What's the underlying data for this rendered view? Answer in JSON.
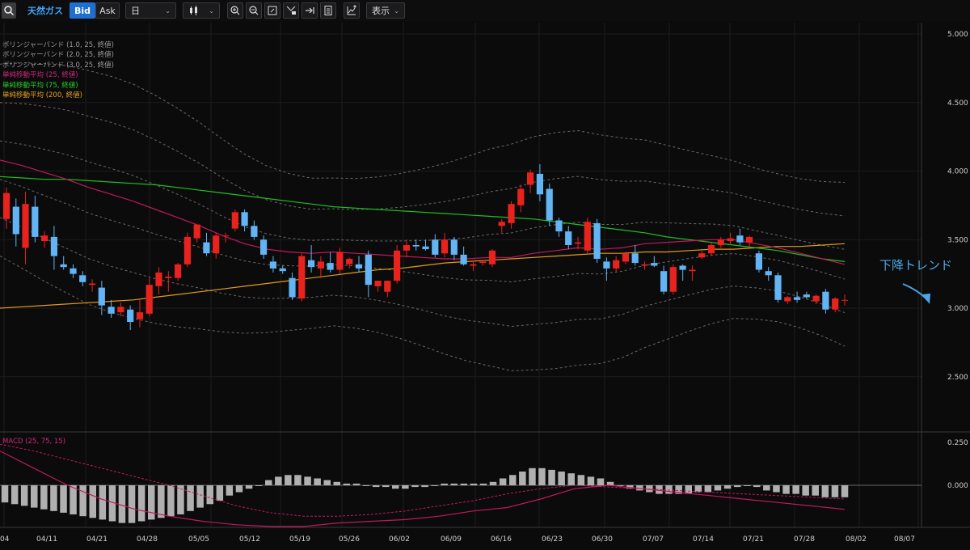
{
  "toolbar": {
    "symbol": "天然ガス",
    "bid_label": "Bid",
    "ask_label": "Ask",
    "timeframe": "日",
    "display_label": "表示"
  },
  "colors": {
    "up": "#e8221d",
    "down": "#62b4f4",
    "sma25": "#c2185b",
    "sma75": "#20c020",
    "sma200": "#e39a1e",
    "band": "#8a8a8a",
    "macd_line": "#c2185b",
    "histogram": "#b0b0b0",
    "annotation": "#4aa8ea"
  },
  "legend": {
    "bb1": "ボリンジャーバンド (1.0, 25, 終値)",
    "bb2": "ボリンジャーバンド (2.0, 25, 終値)",
    "bb3": "ボリンジャーバンド (3.0, 25, 終値)",
    "sma25": "単純移動平均 (25, 終値)",
    "sma75": "単純移動平均 (75, 終値)",
    "sma200": "単純移動平均 (200, 終値)"
  },
  "macd_legend": "MACD (25, 75, 15)",
  "annotation": "下降トレンド",
  "chart_data": [
    {
      "type": "candlestick",
      "x_ticks": [
        "04",
        "04/11",
        "04/21",
        "04/28",
        "05/05",
        "05/12",
        "05/19",
        "05/26",
        "06/02",
        "06/09",
        "06/16",
        "06/23",
        "06/30",
        "07/07",
        "07/14",
        "07/21",
        "07/28",
        "08/02",
        "08/07"
      ],
      "y_ticks": [
        "5.000",
        "4.500",
        "4.000",
        "3.500",
        "3.000",
        "2.500"
      ],
      "ylim": [
        2.2,
        5.05
      ],
      "candles": [
        {
          "o": 3.65,
          "h": 3.88,
          "l": 3.58,
          "c": 3.84
        },
        {
          "o": 3.74,
          "h": 3.8,
          "l": 3.45,
          "c": 3.54
        },
        {
          "o": 3.44,
          "h": 3.85,
          "l": 3.32,
          "c": 3.76
        },
        {
          "o": 3.74,
          "h": 3.82,
          "l": 3.48,
          "c": 3.52
        },
        {
          "o": 3.49,
          "h": 3.56,
          "l": 3.44,
          "c": 3.53
        },
        {
          "o": 3.52,
          "h": 3.6,
          "l": 3.28,
          "c": 3.38
        },
        {
          "o": 3.32,
          "h": 3.38,
          "l": 3.28,
          "c": 3.3
        },
        {
          "o": 3.29,
          "h": 3.32,
          "l": 3.22,
          "c": 3.25
        },
        {
          "o": 3.24,
          "h": 3.27,
          "l": 3.16,
          "c": 3.19
        },
        {
          "o": 3.17,
          "h": 3.21,
          "l": 3.12,
          "c": 3.18
        },
        {
          "o": 3.15,
          "h": 3.2,
          "l": 2.95,
          "c": 3.02
        },
        {
          "o": 3.01,
          "h": 3.06,
          "l": 2.93,
          "c": 2.96
        },
        {
          "o": 2.97,
          "h": 3.04,
          "l": 2.94,
          "c": 3.01
        },
        {
          "o": 2.99,
          "h": 3.02,
          "l": 2.84,
          "c": 2.9
        },
        {
          "o": 2.92,
          "h": 3.06,
          "l": 2.86,
          "c": 2.97
        },
        {
          "o": 2.96,
          "h": 3.22,
          "l": 2.94,
          "c": 3.17
        },
        {
          "o": 3.16,
          "h": 3.3,
          "l": 3.1,
          "c": 3.26
        },
        {
          "o": 3.22,
          "h": 3.27,
          "l": 3.12,
          "c": 3.23
        },
        {
          "o": 3.22,
          "h": 3.33,
          "l": 3.2,
          "c": 3.32
        },
        {
          "o": 3.32,
          "h": 3.55,
          "l": 3.3,
          "c": 3.52
        },
        {
          "o": 3.51,
          "h": 3.6,
          "l": 3.48,
          "c": 3.61
        },
        {
          "o": 3.48,
          "h": 3.55,
          "l": 3.38,
          "c": 3.4
        },
        {
          "o": 3.4,
          "h": 3.55,
          "l": 3.36,
          "c": 3.53
        },
        {
          "o": 3.53,
          "h": 3.55,
          "l": 3.48,
          "c": 3.53
        },
        {
          "o": 3.58,
          "h": 3.72,
          "l": 3.56,
          "c": 3.7
        },
        {
          "o": 3.7,
          "h": 3.72,
          "l": 3.56,
          "c": 3.6
        },
        {
          "o": 3.6,
          "h": 3.64,
          "l": 3.5,
          "c": 3.52
        },
        {
          "o": 3.5,
          "h": 3.53,
          "l": 3.36,
          "c": 3.39
        },
        {
          "o": 3.34,
          "h": 3.38,
          "l": 3.26,
          "c": 3.29
        },
        {
          "o": 3.29,
          "h": 3.31,
          "l": 3.25,
          "c": 3.27
        },
        {
          "o": 3.22,
          "h": 3.26,
          "l": 3.06,
          "c": 3.08
        },
        {
          "o": 3.07,
          "h": 3.4,
          "l": 3.05,
          "c": 3.38
        },
        {
          "o": 3.35,
          "h": 3.46,
          "l": 3.26,
          "c": 3.3
        },
        {
          "o": 3.29,
          "h": 3.38,
          "l": 3.22,
          "c": 3.34
        },
        {
          "o": 3.33,
          "h": 3.41,
          "l": 3.26,
          "c": 3.28
        },
        {
          "o": 3.28,
          "h": 3.44,
          "l": 3.25,
          "c": 3.41
        },
        {
          "o": 3.32,
          "h": 3.37,
          "l": 3.29,
          "c": 3.36
        },
        {
          "o": 3.32,
          "h": 3.38,
          "l": 3.26,
          "c": 3.29
        },
        {
          "o": 3.39,
          "h": 3.42,
          "l": 3.08,
          "c": 3.17
        },
        {
          "o": 3.16,
          "h": 3.2,
          "l": 3.12,
          "c": 3.2
        },
        {
          "o": 3.12,
          "h": 3.2,
          "l": 3.08,
          "c": 3.2
        },
        {
          "o": 3.2,
          "h": 3.46,
          "l": 3.18,
          "c": 3.42
        },
        {
          "o": 3.42,
          "h": 3.5,
          "l": 3.37,
          "c": 3.46
        },
        {
          "o": 3.46,
          "h": 3.5,
          "l": 3.42,
          "c": 3.45
        },
        {
          "o": 3.45,
          "h": 3.5,
          "l": 3.42,
          "c": 3.43
        },
        {
          "o": 3.5,
          "h": 3.54,
          "l": 3.37,
          "c": 3.39
        },
        {
          "o": 3.4,
          "h": 3.55,
          "l": 3.37,
          "c": 3.5
        },
        {
          "o": 3.5,
          "h": 3.52,
          "l": 3.35,
          "c": 3.39
        },
        {
          "o": 3.39,
          "h": 3.45,
          "l": 3.31,
          "c": 3.32
        },
        {
          "o": 3.31,
          "h": 3.35,
          "l": 3.27,
          "c": 3.32
        },
        {
          "o": 3.33,
          "h": 3.35,
          "l": 3.31,
          "c": 3.34
        },
        {
          "o": 3.32,
          "h": 3.43,
          "l": 3.3,
          "c": 3.42
        },
        {
          "o": 3.6,
          "h": 3.65,
          "l": 3.55,
          "c": 3.63
        },
        {
          "o": 3.62,
          "h": 3.78,
          "l": 3.58,
          "c": 3.76
        },
        {
          "o": 3.75,
          "h": 3.9,
          "l": 3.7,
          "c": 3.87
        },
        {
          "o": 3.9,
          "h": 4.01,
          "l": 3.84,
          "c": 3.99
        },
        {
          "o": 3.98,
          "h": 4.05,
          "l": 3.78,
          "c": 3.83
        },
        {
          "o": 3.87,
          "h": 3.91,
          "l": 3.6,
          "c": 3.64
        },
        {
          "o": 3.64,
          "h": 3.66,
          "l": 3.52,
          "c": 3.56
        },
        {
          "o": 3.56,
          "h": 3.6,
          "l": 3.43,
          "c": 3.46
        },
        {
          "o": 3.47,
          "h": 3.52,
          "l": 3.43,
          "c": 3.48
        },
        {
          "o": 3.42,
          "h": 3.66,
          "l": 3.4,
          "c": 3.63
        },
        {
          "o": 3.62,
          "h": 3.65,
          "l": 3.33,
          "c": 3.36
        },
        {
          "o": 3.34,
          "h": 3.37,
          "l": 3.2,
          "c": 3.29
        },
        {
          "o": 3.29,
          "h": 3.38,
          "l": 3.26,
          "c": 3.35
        },
        {
          "o": 3.34,
          "h": 3.41,
          "l": 3.32,
          "c": 3.4
        },
        {
          "o": 3.4,
          "h": 3.46,
          "l": 3.31,
          "c": 3.33
        },
        {
          "o": 3.31,
          "h": 3.34,
          "l": 3.28,
          "c": 3.32
        },
        {
          "o": 3.33,
          "h": 3.38,
          "l": 3.3,
          "c": 3.31
        },
        {
          "o": 3.27,
          "h": 3.31,
          "l": 3.1,
          "c": 3.12
        },
        {
          "o": 3.12,
          "h": 3.32,
          "l": 3.1,
          "c": 3.3
        },
        {
          "o": 3.31,
          "h": 3.32,
          "l": 3.2,
          "c": 3.28
        },
        {
          "o": 3.27,
          "h": 3.31,
          "l": 3.2,
          "c": 3.28
        },
        {
          "o": 3.37,
          "h": 3.42,
          "l": 3.36,
          "c": 3.4
        },
        {
          "o": 3.4,
          "h": 3.48,
          "l": 3.38,
          "c": 3.46
        },
        {
          "o": 3.46,
          "h": 3.52,
          "l": 3.44,
          "c": 3.5
        },
        {
          "o": 3.49,
          "h": 3.55,
          "l": 3.46,
          "c": 3.51
        },
        {
          "o": 3.53,
          "h": 3.58,
          "l": 3.46,
          "c": 3.48
        },
        {
          "o": 3.48,
          "h": 3.53,
          "l": 3.44,
          "c": 3.52
        },
        {
          "o": 3.4,
          "h": 3.42,
          "l": 3.26,
          "c": 3.28
        },
        {
          "o": 3.27,
          "h": 3.3,
          "l": 3.2,
          "c": 3.24
        },
        {
          "o": 3.24,
          "h": 3.26,
          "l": 3.04,
          "c": 3.06
        },
        {
          "o": 3.05,
          "h": 3.09,
          "l": 3.03,
          "c": 3.08
        },
        {
          "o": 3.08,
          "h": 3.12,
          "l": 3.04,
          "c": 3.06
        },
        {
          "o": 3.1,
          "h": 3.12,
          "l": 3.07,
          "c": 3.08
        },
        {
          "o": 3.05,
          "h": 3.1,
          "l": 3.03,
          "c": 3.09
        },
        {
          "o": 3.12,
          "h": 3.14,
          "l": 2.96,
          "c": 2.99
        },
        {
          "o": 2.99,
          "h": 3.08,
          "l": 2.97,
          "c": 3.07
        },
        {
          "o": 3.06,
          "h": 3.1,
          "l": 3.02,
          "c": 3.06
        }
      ],
      "sma25": [
        4.08,
        4.04,
        3.99,
        3.94,
        3.88,
        3.83,
        3.78,
        3.72,
        3.66,
        3.6,
        3.53,
        3.47,
        3.43,
        3.41,
        3.4,
        3.41,
        3.4,
        3.39,
        3.38,
        3.37,
        3.36,
        3.36,
        3.37,
        3.37,
        3.4,
        3.42,
        3.44,
        3.43,
        3.44,
        3.47,
        3.48,
        3.49,
        3.5,
        3.5,
        3.47,
        3.44,
        3.4,
        3.36,
        3.32
      ],
      "sma75": [
        3.96,
        3.95,
        3.94,
        3.94,
        3.93,
        3.92,
        3.91,
        3.9,
        3.88,
        3.86,
        3.84,
        3.82,
        3.8,
        3.78,
        3.76,
        3.74,
        3.73,
        3.72,
        3.71,
        3.7,
        3.69,
        3.68,
        3.67,
        3.66,
        3.65,
        3.63,
        3.61,
        3.59,
        3.57,
        3.55,
        3.52,
        3.5,
        3.48,
        3.46,
        3.44,
        3.42,
        3.39,
        3.36,
        3.34
      ],
      "sma200": [
        3.0,
        3.01,
        3.02,
        3.03,
        3.04,
        3.05,
        3.06,
        3.08,
        3.1,
        3.12,
        3.14,
        3.16,
        3.18,
        3.2,
        3.22,
        3.24,
        3.26,
        3.28,
        3.29,
        3.31,
        3.33,
        3.34,
        3.35,
        3.36,
        3.37,
        3.38,
        3.39,
        3.4,
        3.4,
        3.41,
        3.41,
        3.42,
        3.43,
        3.43,
        3.44,
        3.45,
        3.45,
        3.46,
        3.47
      ]
    },
    {
      "type": "histogram",
      "name": "MACD (25, 75, 15)",
      "y_ticks": [
        "0.250",
        "0.000"
      ],
      "ylim": [
        -0.35,
        0.3
      ],
      "histogram": [
        -0.1,
        -0.11,
        -0.12,
        -0.13,
        -0.14,
        -0.15,
        -0.16,
        -0.17,
        -0.18,
        -0.19,
        -0.2,
        -0.21,
        -0.22,
        -0.22,
        -0.21,
        -0.2,
        -0.19,
        -0.18,
        -0.17,
        -0.15,
        -0.13,
        -0.11,
        -0.09,
        -0.06,
        -0.04,
        -0.02,
        0.0,
        0.03,
        0.05,
        0.06,
        0.06,
        0.05,
        0.04,
        0.03,
        0.02,
        0.01,
        0.01,
        0.0,
        -0.01,
        -0.01,
        -0.02,
        -0.02,
        -0.01,
        -0.01,
        0.0,
        0.01,
        0.01,
        0.01,
        0.01,
        0.01,
        0.02,
        0.04,
        0.06,
        0.08,
        0.1,
        0.1,
        0.09,
        0.08,
        0.07,
        0.06,
        0.05,
        0.04,
        0.02,
        0.0,
        -0.02,
        -0.03,
        -0.04,
        -0.05,
        -0.05,
        -0.05,
        -0.05,
        -0.04,
        -0.04,
        -0.03,
        -0.02,
        -0.01,
        0.0,
        -0.01,
        -0.03,
        -0.04,
        -0.05,
        -0.05,
        -0.06,
        -0.06,
        -0.07,
        -0.07,
        -0.07
      ],
      "macd": [
        0.2,
        0.1,
        0.0,
        -0.08,
        -0.14,
        -0.18,
        -0.21,
        -0.23,
        -0.24,
        -0.24,
        -0.22,
        -0.21,
        -0.2,
        -0.18,
        -0.15,
        -0.13,
        -0.08,
        -0.02,
        0.0,
        -0.02,
        -0.04,
        -0.06,
        -0.08,
        -0.1,
        -0.12,
        -0.14
      ],
      "signal": [
        0.24,
        0.2,
        0.15,
        0.1,
        0.05,
        0.0,
        -0.06,
        -0.12,
        -0.16,
        -0.18,
        -0.18,
        -0.17,
        -0.15,
        -0.12,
        -0.09,
        -0.05,
        -0.02,
        0.0,
        -0.01,
        -0.02,
        -0.03,
        -0.04,
        -0.05,
        -0.06,
        -0.07,
        -0.08
      ]
    }
  ]
}
